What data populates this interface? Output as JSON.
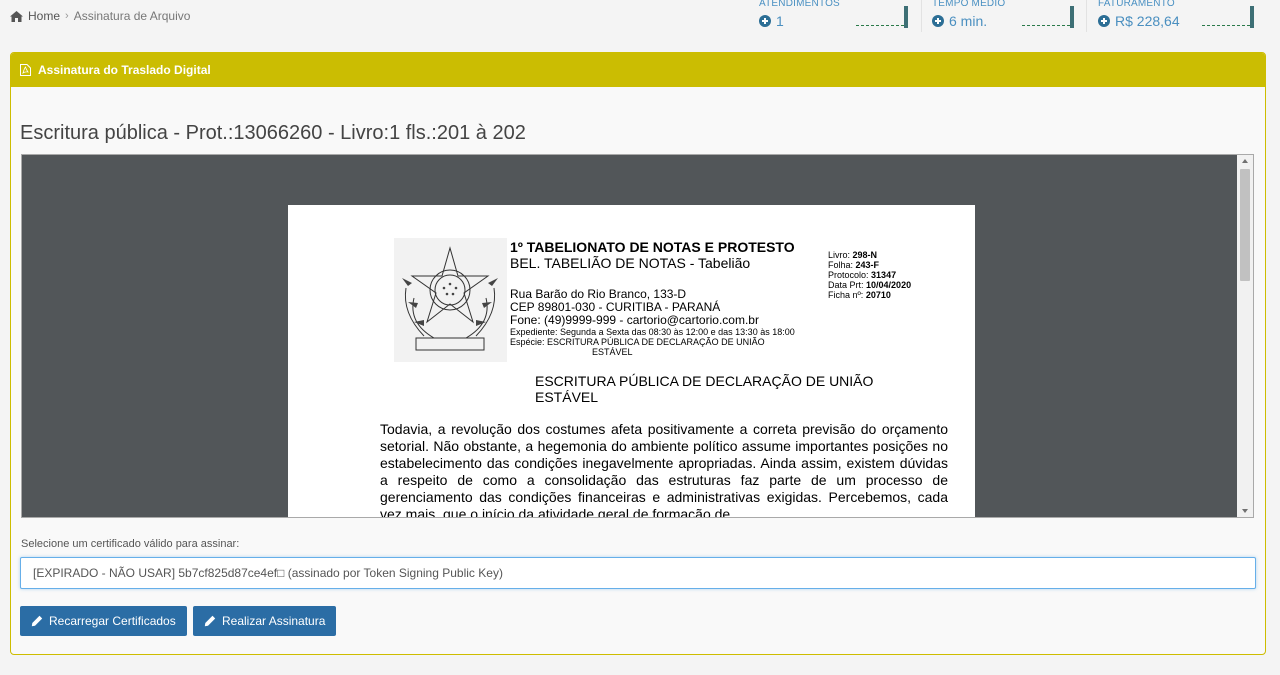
{
  "breadcrumb": {
    "home": "Home",
    "separator": "›",
    "current": "Assinatura de Arquivo"
  },
  "stats": [
    {
      "label": "ATENDIMENTOS",
      "value": "1"
    },
    {
      "label": "TEMPO MÉDIO",
      "value": "6 min."
    },
    {
      "label": "FATURAMENTO",
      "value": "R$ 228,64"
    }
  ],
  "panel": {
    "title": "Assinatura do Traslado Digital"
  },
  "document_title": "Escritura pública - Prot.:13066260 - Livro:1 fls.:201 à 202",
  "pdf_page": {
    "org_name": "1º TABELIONATO DE NOTAS E PROTESTO",
    "org_sub": "BEL. TABELIÃO DE NOTAS - Tabelião",
    "address_1": "Rua Barão do Rio Branco, 133-D",
    "address_2": "CEP 89801-030 - CURITIBA - PARANÁ",
    "contact": "Fone: (49)9999-999 - cartorio@cartorio.com.br",
    "hours": "Expediente: Segunda a Sexta das 08:30 às 12:00 e das 13:30 às 18:00",
    "species_1": "Espécie: ESCRITURA PÚBLICA DE DECLARAÇÃO DE UNIÃO",
    "species_2": "ESTÁVEL",
    "meta": {
      "livro_label": "Livro:",
      "livro": "298-N",
      "folha_label": "Folha:",
      "folha": "243-F",
      "protocolo_label": "Protocolo:",
      "protocolo": "31347",
      "data_label": "Data Prt:",
      "data": "10/04/2020",
      "ficha_label": "Ficha nº:",
      "ficha": "20710"
    },
    "heading": "ESCRITURA PÚBLICA DE DECLARAÇÃO DE UNIÃO ESTÁVEL",
    "body": "Todavia, a revolução dos costumes afeta positivamente a correta previsão do orçamento setorial. Não obstante, a hegemonia do ambiente político assume importantes posições no estabelecimento das condições inegavelmente apropriadas. Ainda assim, existem dúvidas a respeito de como a consolidação das estruturas faz parte de um processo de gerenciamento das condições financeiras e administrativas exigidas. Percebemos, cada vez mais, que o início da atividade geral de formação de"
  },
  "certificate": {
    "label": "Selecione um certificado válido para assinar:",
    "selected": "[EXPIRADO - NÃO USAR] 5b7cf825d87ce4ef□ (assinado por Token Signing Public Key)"
  },
  "buttons": {
    "reload": "Recarregar Certificados",
    "sign": "Realizar Assinatura"
  },
  "colors": {
    "panel_header": "#cbbd02",
    "button": "#2b6da5",
    "stat_value": "#4a8fc0",
    "viewer_bg": "#525659"
  }
}
